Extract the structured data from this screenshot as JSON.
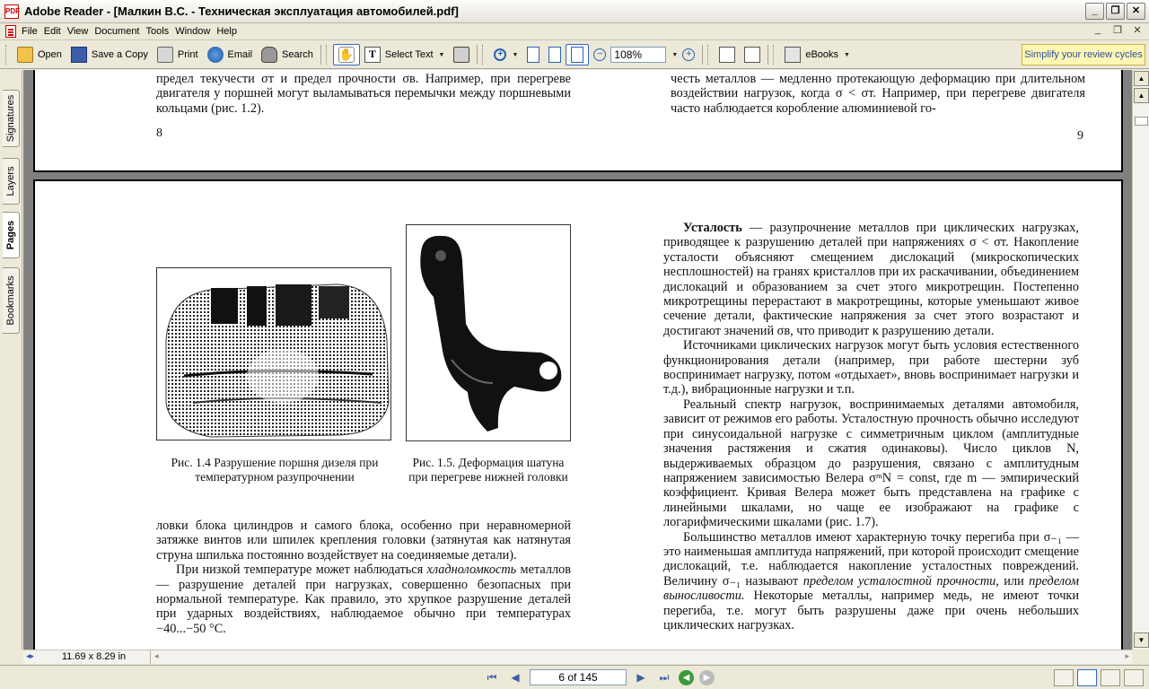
{
  "window": {
    "title": "Adobe Reader - [Малкин В.С. - Техническая эксплуатация автомобилей.pdf]",
    "app_icon_label": "PDF"
  },
  "menu": [
    "File",
    "Edit",
    "View",
    "Document",
    "Tools",
    "Window",
    "Help"
  ],
  "toolbar": {
    "open": "Open",
    "save_copy": "Save a Copy",
    "print": "Print",
    "email": "Email",
    "search": "Search",
    "select_text": "Select Text",
    "zoom": "108%",
    "ebooks": "eBooks",
    "promo": "Simplify your review cycles"
  },
  "side_tabs": [
    "Signatures",
    "Layers",
    "Pages",
    "Bookmarks"
  ],
  "page_top": {
    "left_text": "предел текучести σт и предел прочности σв. Например, при перегреве двигателя у поршней могут выламываться перемычки между поршневыми кольцами (рис. 1.2).",
    "left_num": "8",
    "right_text": "честь металлов — медленно протекающую деформацию при длительном воздействии нагрузок, когда σ < σт. Например, при перегреве двигателя часто наблюдается коробление алюминиевой го-",
    "right_num": "9"
  },
  "page_bottom": {
    "caption_1": "Рис. 1.4  Разрушение поршня дизеля при температурном разупрочнении",
    "caption_2": "Рис. 1.5. Деформация шатуна при перегреве нижней головки",
    "left_p1": "ловки блока цилиндров и самого блока, особенно при неравномерной затяжке винтов или шпилек крепления головки (затянутая как натянутая струна шпилька постоянно воздействует на соединяемые детали).",
    "left_p2_a": "При низкой температуре может наблюдаться ",
    "left_p2_it": "хладноломкость",
    "left_p2_b": " металлов — разрушение деталей при нагрузках, совершенно безопасных при нормальной температуре. Как правило, это хрупкое разрушение деталей при ударных воздействиях, наблюдаемое обычно при температурах −40...−50 °С.",
    "right_p1_bold": "Усталость",
    "right_p1": " — разупрочнение металлов при циклических нагрузках, приводящее к разрушению деталей при напряжениях σ < σт. Накопление усталости объясняют смещением дислокаций (микроскопических несплошностей) на гранях кристаллов при их раскачивании, объединением дислокаций и образованием за счет этого микротрещин. Постепенно микротрещины перерастают в макротрещины, которые уменьшают живое сечение детали, фактические напряжения за счет этого возрастают и достигают значений σв, что приводит к разрушению детали.",
    "right_p2": "Источниками циклических нагрузок могут быть условия естественного функционирования детали (например, при работе шестерни зуб воспринимает нагрузку, потом «отдыхает», вновь воспринимает нагрузки и т.д.), вибрационные нагрузки и т.п.",
    "right_p3": "Реальный спектр нагрузок, воспринимаемых деталями автомобиля, зависит от режимов его работы. Усталостную прочность обычно исследуют при синусоидальной нагрузке с симметричным циклом (амплитудные значения растяжения и сжатия одинаковы). Число циклов N, выдерживаемых образцом до разрушения, связано с амплитудным напряжением зависимостью Велера σᵐN = const, где m — эмпирический коэффициент. Кривая Велера может быть представлена на графике с линейными шкалами, но чаще ее изображают на графике с логарифмическими шкалами (рис. 1.7).",
    "right_p4_a": "Большинство металлов имеют характерную точку перегиба при σ₋₁ — это наименьшая амплитуда напряжений, при которой происходит смещение дислокаций, т.е. наблюдается накопление усталостных повреждений. Величину σ₋₁ называют ",
    "right_p4_it1": "пределом усталостной прочности,",
    "right_p4_or": " или ",
    "right_p4_it2": "пределом выносливости.",
    "right_p4_b": " Некоторые металлы, например медь, не имеют точки перегиба, т.е. могут быть разрушены даже при очень небольших циклических нагрузках."
  },
  "status": {
    "page_size": "11.69 x 8.29 in",
    "page_indicator": "6 of 145"
  }
}
